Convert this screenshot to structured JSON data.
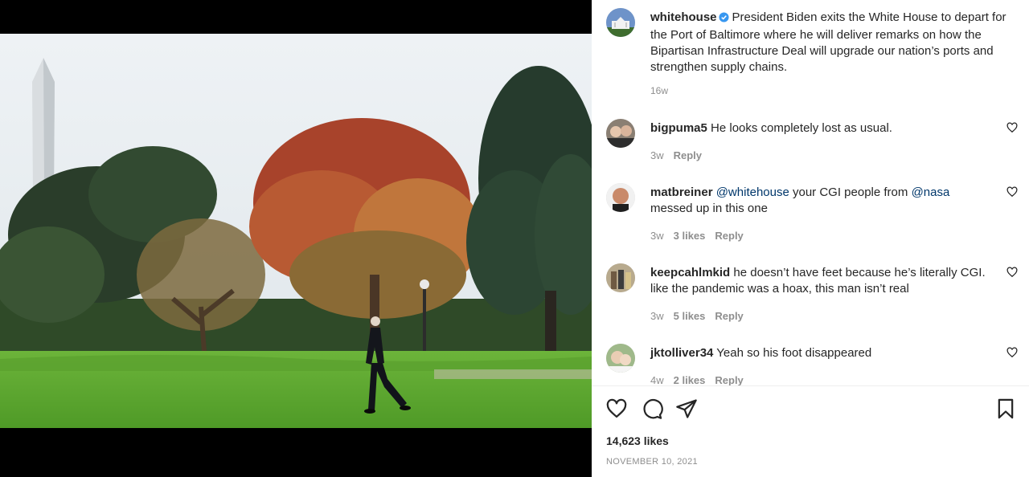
{
  "post": {
    "author": "whitehouse",
    "caption": "President Biden exits the White House to depart for the Port of Baltimore where he will deliver remarks on how the Bipartisan Infrastructure Deal will upgrade our nation’s ports and strengthen supply chains.",
    "time_ago": "16w",
    "likes": "14,623 likes",
    "date": "NOVEMBER 10, 2021"
  },
  "comments": [
    {
      "username": "bigpuma5",
      "text": "He looks completely lost as usual.",
      "time": "3w",
      "likes": "",
      "reply": "Reply"
    },
    {
      "username": "matbreiner",
      "mention1": "@whitehouse",
      "text_mid": " your CGI people from ",
      "mention2": "@nasa",
      "text_end": " messed up in this one",
      "time": "3w",
      "likes": "3 likes",
      "reply": "Reply"
    },
    {
      "username": "keepcahlmkid",
      "text": "he doesn’t have feet because he’s literally CGI. like the pandemic was a hoax, this man isn’t real",
      "time": "3w",
      "likes": "5 likes",
      "reply": "Reply"
    },
    {
      "username": "jktolliver34",
      "text": "Yeah so his foot disappeared",
      "time": "4w",
      "likes": "2 likes",
      "reply": "Reply"
    }
  ],
  "icons": {
    "verified": "verified-badge-icon",
    "like": "heart-icon",
    "comment": "comment-bubble-icon",
    "share": "paper-plane-icon",
    "save": "bookmark-icon"
  },
  "colors": {
    "verified": "#3897f0",
    "mention": "#00376b",
    "muted": "#8e8e8e"
  }
}
